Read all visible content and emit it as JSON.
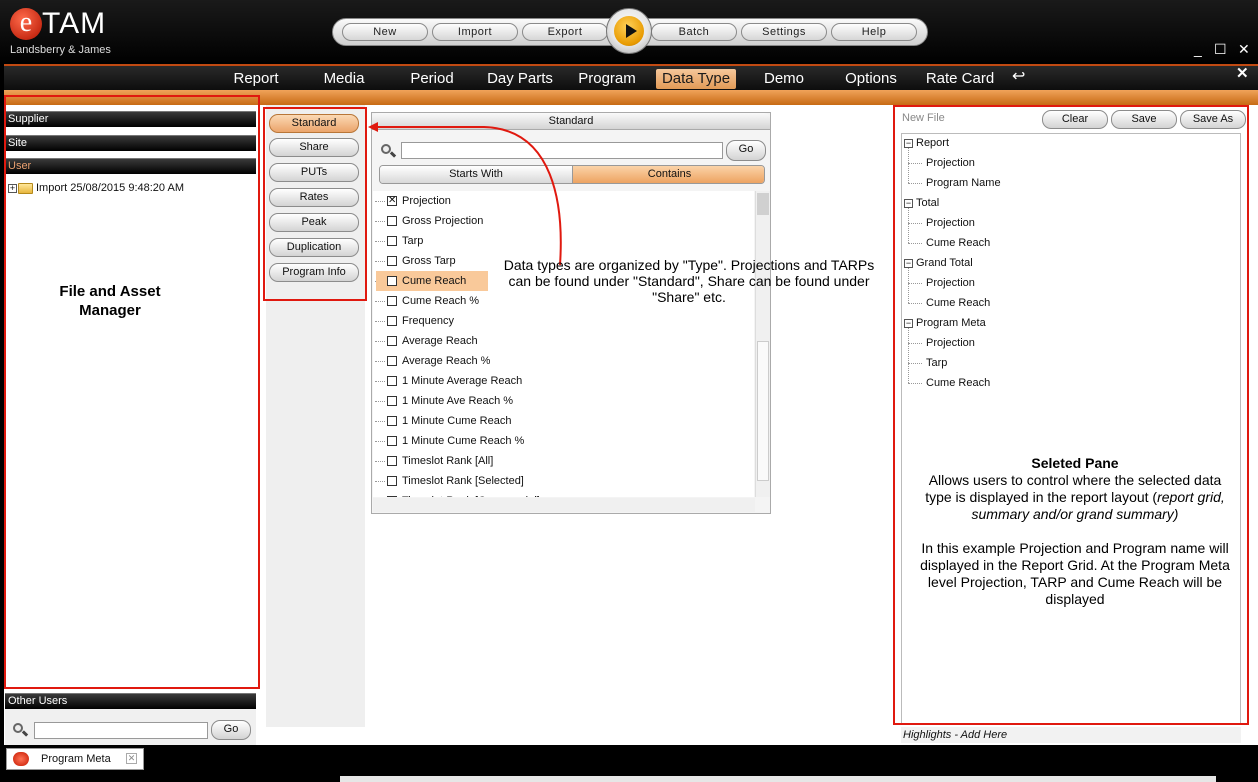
{
  "logo": {
    "e": "e",
    "tam": "TAM",
    "subtitle": "Landsberry & James"
  },
  "toolbar": {
    "buttons": [
      "New",
      "Import",
      "Export",
      "Batch",
      "Settings",
      "Help"
    ],
    "play_icon": "play-icon"
  },
  "window": {
    "minimize": "_",
    "maximize": "☐",
    "close": "✕"
  },
  "menu": {
    "items": [
      "Report",
      "Media",
      "Period",
      "Day Parts",
      "Program",
      "Data Type",
      "Demo",
      "Options",
      "Rate Card"
    ],
    "active": "Data Type",
    "back_icon": "↩",
    "close": "✕"
  },
  "left": {
    "supplier": "Supplier",
    "site": "Site",
    "user": "User",
    "import_item": "Import 25/08/2015 9:48:20 AM",
    "other_users": "Other Users",
    "go": "Go"
  },
  "types": [
    "Standard",
    "Share",
    "PUTs",
    "Rates",
    "Peak",
    "Duplication",
    "Program Info"
  ],
  "active_type": "Standard",
  "standard": {
    "header": "Standard",
    "go": "Go",
    "starts_with": "Starts With",
    "contains": "Contains",
    "items": [
      {
        "label": "Projection",
        "checked": true
      },
      {
        "label": "Gross Projection",
        "checked": false
      },
      {
        "label": "Tarp",
        "checked": false
      },
      {
        "label": "Gross Tarp",
        "checked": false
      },
      {
        "label": "Cume Reach",
        "checked": false,
        "highlight": true
      },
      {
        "label": "Cume Reach %",
        "checked": false
      },
      {
        "label": "Frequency",
        "checked": false
      },
      {
        "label": "Average Reach",
        "checked": false
      },
      {
        "label": "Average Reach %",
        "checked": false
      },
      {
        "label": "1 Minute Average Reach",
        "checked": false
      },
      {
        "label": "1 Minute Ave Reach %",
        "checked": false
      },
      {
        "label": "1 Minute Cume Reach",
        "checked": false
      },
      {
        "label": "1 Minute Cume Reach %",
        "checked": false
      },
      {
        "label": "Timeslot Rank [All]",
        "checked": false
      },
      {
        "label": "Timeslot Rank [Selected]",
        "checked": false
      },
      {
        "label": "Timeslot Rank [Commercial]",
        "checked": false
      }
    ]
  },
  "annotations": {
    "file_asset": "File and Asset\nManager",
    "data_types": "Data types are organized by \"Type\".  Projections and TARPs can be found under \"Standard\", Share can be found under \"Share\" etc.",
    "selected_title": "Seleted Pane",
    "selected_body1": "Allows users to control where the selected data type is displayed in the report layout (",
    "selected_body1_italic": "report grid, summary and/or grand summary)",
    "selected_body2": "In this example Projection and Program name will displayed in the Report Grid.  At the Program Meta level Projection, TARP and Cume Reach will be displayed"
  },
  "right": {
    "new_file": "New File",
    "clear": "Clear",
    "save": "Save",
    "save_as": "Save As",
    "tree": [
      {
        "group": "Report",
        "children": [
          "Projection",
          "Program Name"
        ]
      },
      {
        "group": "Total",
        "children": [
          "Projection",
          "Cume Reach"
        ]
      },
      {
        "group": "Grand Total",
        "children": [
          "Projection",
          "Cume Reach"
        ]
      },
      {
        "group": "Program Meta",
        "children": [
          "Projection",
          "Tarp",
          "Cume Reach"
        ]
      }
    ],
    "highlights": "Highlights - Add Here"
  },
  "bottom": {
    "tab": "Program Meta"
  },
  "colors": {
    "accent": "#e89a56",
    "annotation_red": "#e0190f"
  }
}
